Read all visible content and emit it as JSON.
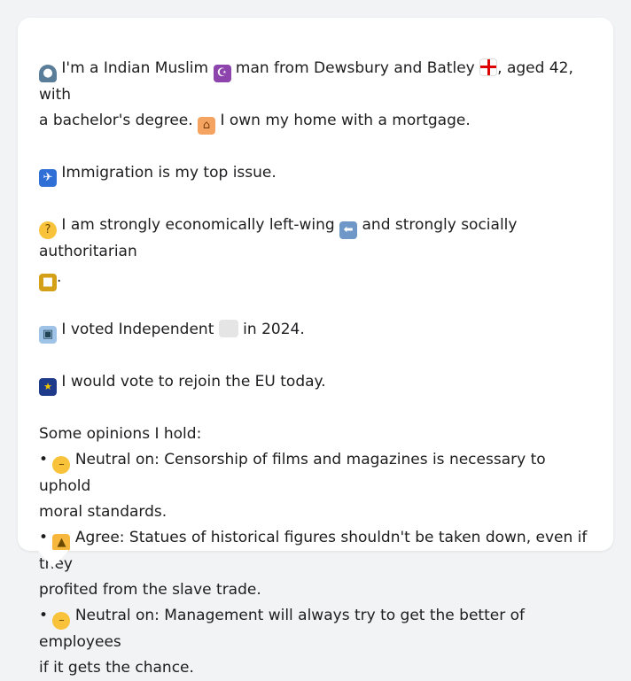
{
  "profile": {
    "line1_a": "I'm a Indian Muslim",
    "line1_b": "man from Dewsbury and Batley",
    "line1_c": ", aged 42, with",
    "line2_a": "a bachelor's degree.",
    "line2_b": "I own my home with a mortgage."
  },
  "issue": {
    "text": "Immigration is my top issue."
  },
  "ideology": {
    "text_a": "I am strongly economically left-wing",
    "text_b": "and strongly socially authoritarian",
    "text_c": "."
  },
  "vote": {
    "text_a": "I voted Independent",
    "text_b": "in 2024."
  },
  "eu": {
    "text": "I would vote to rejoin the EU today."
  },
  "opinions": {
    "heading": "Some opinions I hold:",
    "items": [
      {
        "bullet": "•",
        "stance": "Neutral on: Censorship of films and magazines is necessary to uphold",
        "cont": "moral standards."
      },
      {
        "bullet": "•",
        "stance": "Agree: Statues of historical figures shouldn't be taken down, even if they",
        "cont": "profited from the slave trade."
      },
      {
        "bullet": "•",
        "stance": "Neutral on: Management will always try to get the better of employees",
        "cont": "if it gets the chance."
      }
    ]
  },
  "icons": {
    "person": "bust-in-silhouette-icon",
    "religion": "star-and-crescent-icon",
    "region": "england-flag-icon",
    "home": "house-icon",
    "issue": "passport-control-icon",
    "thinking": "thinking-face-icon",
    "left": "left-arrow-icon",
    "authoritarian": "lock-icon",
    "ballot": "ballot-box-icon",
    "party": "independent-color-swatch-icon",
    "eu": "eu-flag-icon",
    "neutral": "neutral-face-icon",
    "agree": "thumbs-up-icon"
  },
  "colors": {
    "background": "#f2f3f5",
    "card": "#ffffff",
    "text": "#1d1d1f",
    "independent_swatch": "#e5e5e5"
  }
}
